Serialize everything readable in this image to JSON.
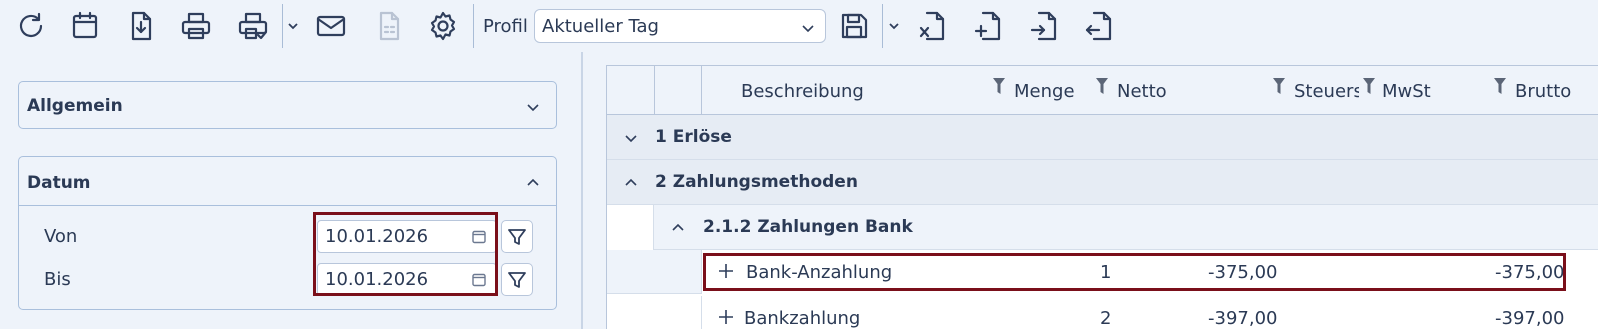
{
  "toolbar": {
    "buttons": [
      {
        "icon": "refresh-icon"
      },
      {
        "icon": "calendar-icon"
      },
      {
        "icon": "file-download-icon"
      },
      {
        "icon": "print-icon"
      },
      {
        "icon": "print-settings-icon"
      },
      {
        "icon": "mail-icon"
      },
      {
        "icon": "document-disabled-icon"
      },
      {
        "icon": "gear-icon"
      }
    ],
    "profil_label": "Profil",
    "profil_value": "Aktueller Tag",
    "export_buttons": [
      {
        "icon": "export-excel-icon"
      },
      {
        "icon": "file-add-icon"
      },
      {
        "icon": "file-import-icon"
      },
      {
        "icon": "file-export-icon"
      }
    ]
  },
  "left": {
    "general_title": "Allgemein",
    "date_title": "Datum",
    "from_label": "Von",
    "from_value": "10.01.2026",
    "to_label": "Bis",
    "to_value": "10.01.2026"
  },
  "grid": {
    "columns": [
      "Beschreibung",
      "Menge",
      "Netto",
      "Steuers",
      "MwSt",
      "Brutto"
    ],
    "groups": [
      {
        "title": "1 Erlöse",
        "expanded": false
      },
      {
        "title": "2 Zahlungsmethoden",
        "expanded": true
      },
      {
        "title": "2.1.2 Zahlungen Bank",
        "expanded": true
      }
    ],
    "rows": [
      {
        "description": "Bank-Anzahlung",
        "quantity": "1",
        "net": "-375,00",
        "gross": "-375,00"
      },
      {
        "description": "Bankzahlung",
        "quantity": "2",
        "net": "-397,00",
        "gross": "-397,00"
      }
    ]
  },
  "colors": {
    "highlight": "#7a0f1a",
    "background": "#eef3fa",
    "text": "#2b3a55"
  }
}
